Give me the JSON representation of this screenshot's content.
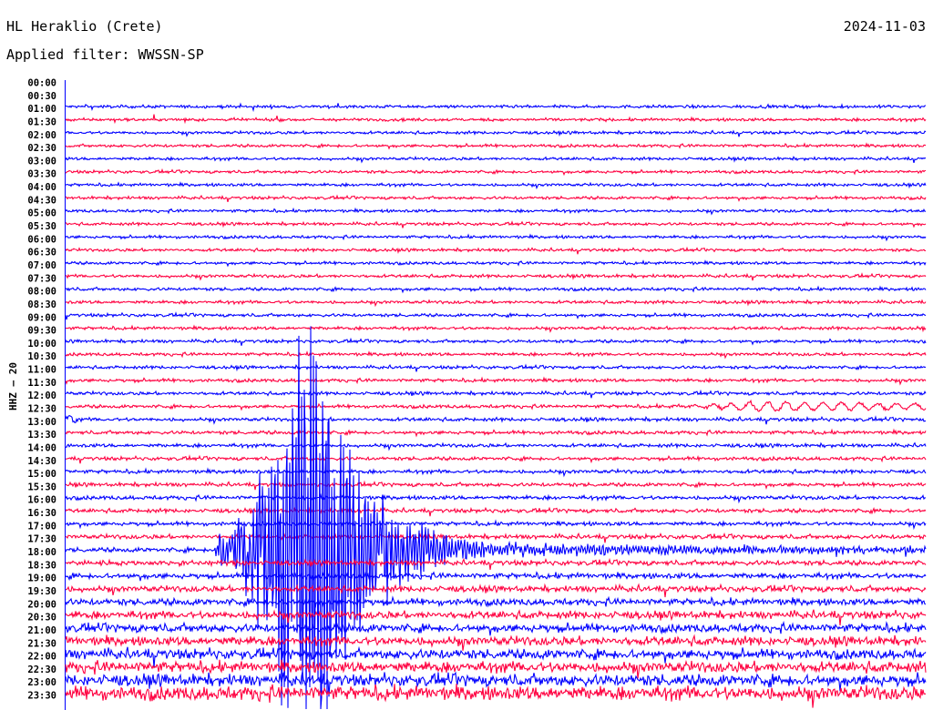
{
  "header": {
    "station": "HL Heraklio (Crete)",
    "date": "2024-11-03",
    "filter": "Applied filter: WWSSN-SP"
  },
  "chart_data": {
    "type": "line",
    "subtype": "helicorder",
    "title": "HL Heraklio (Crete)",
    "ylabel": "HHZ – 20",
    "row_minutes": 30,
    "row_labels": [
      "00:00",
      "00:30",
      "01:00",
      "01:30",
      "02:00",
      "02:30",
      "03:00",
      "03:30",
      "04:00",
      "04:30",
      "05:00",
      "05:30",
      "06:00",
      "06:30",
      "07:00",
      "07:30",
      "08:00",
      "08:30",
      "09:00",
      "09:30",
      "10:00",
      "10:30",
      "11:00",
      "11:30",
      "12:00",
      "12:30",
      "13:00",
      "13:30",
      "14:00",
      "14:30",
      "15:00",
      "15:30",
      "16:00",
      "16:30",
      "17:00",
      "17:30",
      "18:00",
      "18:30",
      "19:00",
      "19:30",
      "20:00",
      "20:30",
      "21:00",
      "21:30",
      "22:00",
      "22:30",
      "23:00",
      "23:30"
    ],
    "colors": [
      "#0000ff",
      "#ff0040"
    ],
    "first_data_row": 2,
    "noise_level": [
      0,
      0,
      1.5,
      1.5,
      1.5,
      1.5,
      1.5,
      1.5,
      1.5,
      1.5,
      1.5,
      1.5,
      1.5,
      1.5,
      1.5,
      1.6,
      1.6,
      1.6,
      1.6,
      1.6,
      1.6,
      1.6,
      1.6,
      1.7,
      1.7,
      1.7,
      1.8,
      1.8,
      1.8,
      1.8,
      1.9,
      1.9,
      2,
      2,
      2,
      2.2,
      2.3,
      2.5,
      2.8,
      3,
      3.4,
      3.8,
      4.2,
      4.6,
      5,
      5.5,
      6,
      7
    ],
    "events": [
      {
        "row": "18:00",
        "start_minute": 5.2,
        "peak_minute": 8.5,
        "peak_amplitude": 300,
        "type": "earthquake"
      },
      {
        "row": "12:30",
        "start_minute": 20.5,
        "peak_minute": 24,
        "peak_amplitude": 5,
        "type": "surface-waves"
      }
    ]
  }
}
